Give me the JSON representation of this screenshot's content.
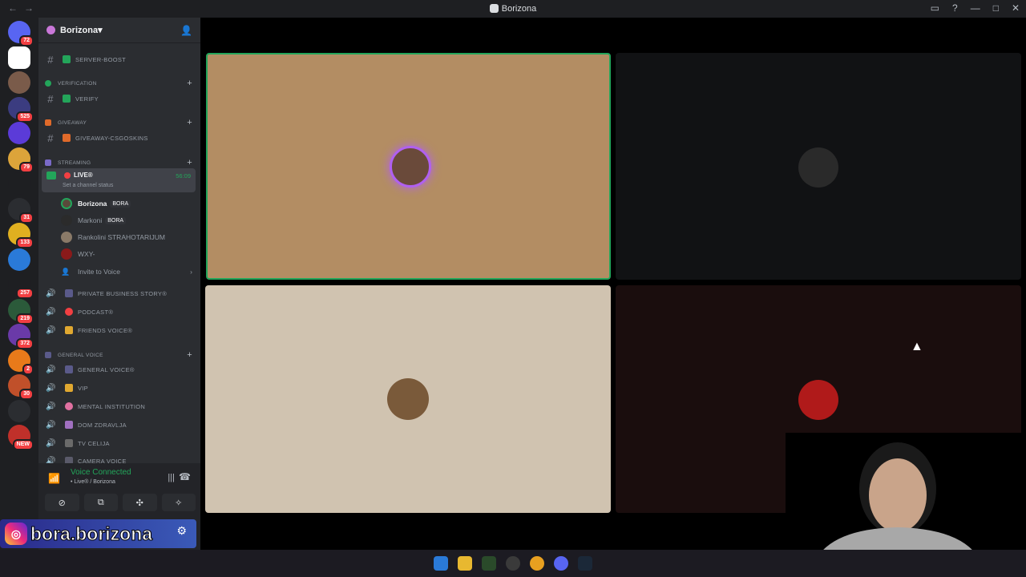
{
  "titlebar": {
    "title": "Borizona",
    "nav_back": "←",
    "nav_fwd": "→"
  },
  "servers": [
    {
      "name": "discord-home",
      "badge": "72",
      "color": "#5865f2"
    },
    {
      "name": "borizona",
      "badge": "",
      "color": "#ffffff"
    },
    {
      "name": "server-beast",
      "badge": "",
      "color": "#7a5b4a"
    },
    {
      "name": "server-geet",
      "badge": "525",
      "color": "#3b3c80"
    },
    {
      "name": "server-fire",
      "badge": "",
      "color": "#5b3bd8"
    },
    {
      "name": "server-z",
      "badge": "79",
      "color": "#dca43a"
    },
    {
      "name": "server-xx",
      "badge": "",
      "color": "#1e1f22"
    },
    {
      "name": "server-star",
      "badge": "31",
      "color": "#2b2d31"
    },
    {
      "name": "server-y",
      "badge": "133",
      "color": "#e0b020"
    },
    {
      "name": "server-blue",
      "badge": "",
      "color": "#2a7ad8"
    },
    {
      "name": "server-book",
      "badge": "257",
      "color": "#1e1f22"
    },
    {
      "name": "server-green",
      "badge": "219",
      "color": "#2b5a3a"
    },
    {
      "name": "server-purple",
      "badge": "372",
      "color": "#6a3aa8"
    },
    {
      "name": "server-orange",
      "badge": "2",
      "color": "#e87a1a"
    },
    {
      "name": "server-face",
      "badge": "30",
      "color": "#c0502a"
    },
    {
      "name": "server-csgoskins",
      "badge": "",
      "color": "#2b2d31"
    },
    {
      "name": "server-new",
      "badge": "NEW",
      "color": "#c0302a"
    }
  ],
  "sidebar": {
    "guild_name": "Borizona",
    "channels": [
      {
        "type": "text",
        "label": "SERVER-BOOST"
      },
      {
        "type": "category",
        "label": "VERIFICATION"
      },
      {
        "type": "text",
        "label": "VERIFY"
      },
      {
        "type": "category",
        "label": "GIVEAWAY"
      },
      {
        "type": "text",
        "label": "GIVEAWAY-CSGOSKINS"
      },
      {
        "type": "category",
        "label": "STREAMING"
      }
    ],
    "live": {
      "label": "LIVE®",
      "time": "56:09",
      "status": "Set a channel status"
    },
    "members": [
      {
        "name": "Borizona",
        "tag": "BORA"
      },
      {
        "name": "Markoni",
        "tag": "BORA"
      },
      {
        "name": "Rankolini STRAHOTARIJUM",
        "tag": ""
      },
      {
        "name": "WXY-",
        "tag": ""
      }
    ],
    "invite": "Invite to Voice",
    "voice_channels": [
      {
        "label": "PRIVATE BUSINESS STORY®"
      },
      {
        "label": "PODCAST®"
      },
      {
        "label": "FRIENDS VOICE®"
      }
    ],
    "general_category": "GENERAL VOICE",
    "general_channels": [
      {
        "label": "GENERAL VOICE®"
      },
      {
        "label": "VIP"
      },
      {
        "label": "MENTAL INSTITUTION"
      },
      {
        "label": "DOM ZDRAVLJA"
      },
      {
        "label": "TV CELIJA"
      },
      {
        "label": "CAMERA VOICE"
      }
    ]
  },
  "voice_panel": {
    "status": "Voice Connected",
    "channel": "• Live® / Borizona"
  },
  "overlay": {
    "instagram_handle": "bora.borizona"
  },
  "tiles": [
    {
      "name": "tile-borizona",
      "bg": "#b38d63",
      "speaking": true
    },
    {
      "name": "tile-markoni",
      "bg": "#111214",
      "speaking": false
    },
    {
      "name": "tile-rankolini",
      "bg": "#d0c3b0",
      "speaking": false
    },
    {
      "name": "tile-wxy",
      "bg": "#1a0d0d",
      "speaking": false
    }
  ]
}
